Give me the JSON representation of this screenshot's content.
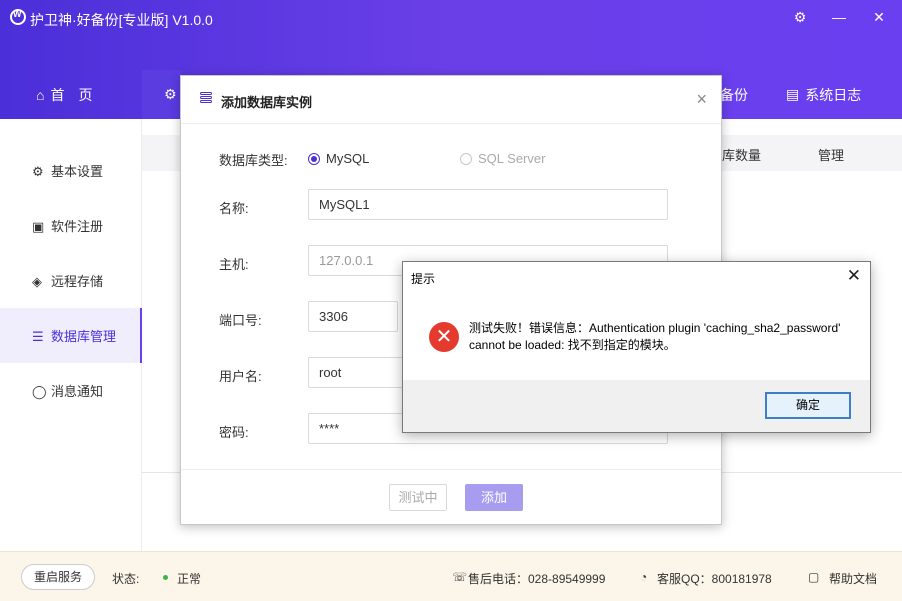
{
  "window": {
    "title": "护卫神·好备份[专业版]  V1.0.0"
  },
  "topnav": {
    "items": [
      "首　页",
      "备份",
      "系统日志"
    ]
  },
  "sidebar": {
    "items": [
      {
        "label": "基本设置",
        "icon": "gear-icon"
      },
      {
        "label": "软件注册",
        "icon": "register-icon"
      },
      {
        "label": "远程存储",
        "icon": "cloud-icon"
      },
      {
        "label": "数据库管理",
        "icon": "database-icon"
      },
      {
        "label": "消息通知",
        "icon": "chat-icon"
      }
    ]
  },
  "table": {
    "headers": [
      "库数量",
      "管理"
    ]
  },
  "dialog": {
    "title": "添加数据库实例",
    "db_type_label": "数据库类型:",
    "options": [
      "MySQL",
      "SQL Server"
    ],
    "selected_option": "MySQL",
    "name_label": "名称:",
    "name_value": "MySQL1",
    "host_label": "主机:",
    "host_value": "127.0.0.1",
    "port_label": "端口号:",
    "port_value": "3306",
    "user_label": "用户名:",
    "user_value": "root",
    "password_label": "密码:",
    "password_value": "****",
    "testing_label": "测试中",
    "add_label": "添加"
  },
  "messagebox": {
    "title": "提示",
    "line1": "测试失败！错误信息：Authentication plugin 'caching_sha2_password'",
    "line2": "cannot be loaded: 找不到指定的模块。",
    "ok_label": "确定"
  },
  "footer": {
    "restart_label": "重启服务",
    "status_label": "状态:",
    "status_value": "正常",
    "phone": "售后电话：028-89549999",
    "qq": "客服QQ：800181978",
    "help": "帮助文档"
  },
  "colors": {
    "brand": "#5b3be6",
    "status_ok": "#3bb54a",
    "error": "#e53b2f"
  }
}
